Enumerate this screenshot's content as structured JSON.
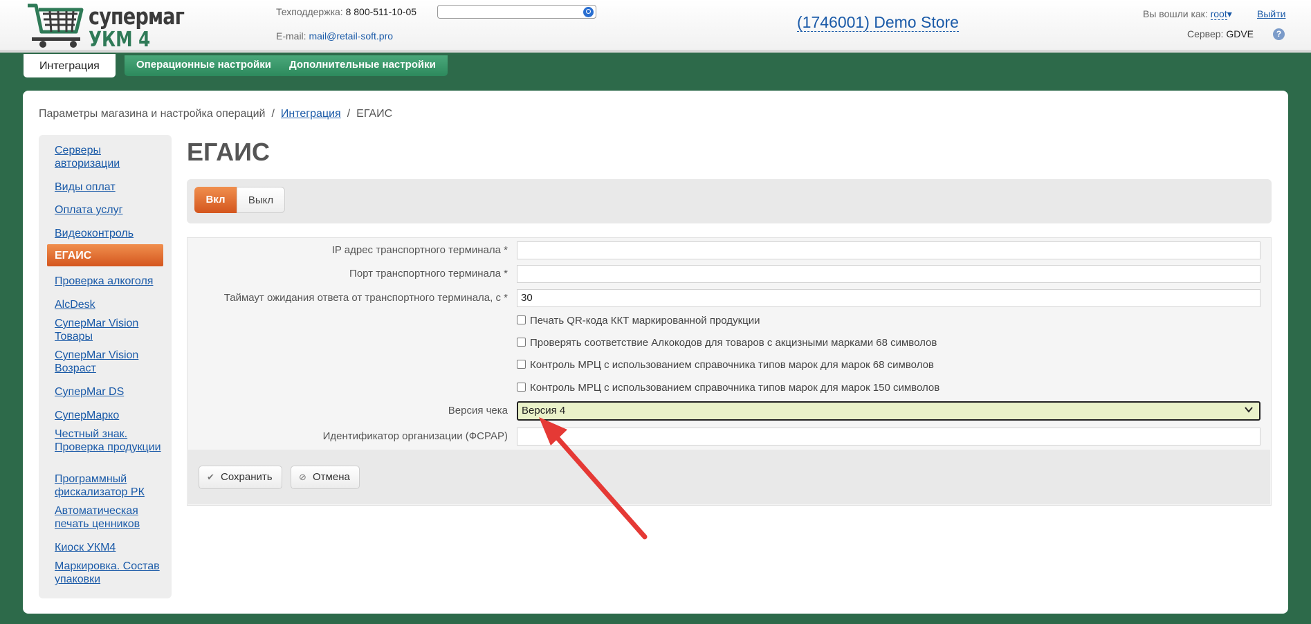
{
  "header": {
    "logo_line1": "супермаг",
    "logo_line2": "УКМ 4",
    "support_label": "Техподдержка:",
    "support_phone": "8 800-511-10-05",
    "email_label": "E-mail:",
    "email": "mail@retail-soft.pro",
    "search_placeholder": "",
    "store_title": "(1746001) Demo Store",
    "login_label": "Вы вошли как:",
    "user": "root",
    "user_caret": "▾",
    "logout": "Выйти",
    "server_label": "Сервер:",
    "server": "GDVE",
    "help_glyph": "?"
  },
  "tabs": [
    {
      "label": "Интеграция"
    },
    {
      "label": "Операционные настройки"
    },
    {
      "label": "Дополнительные настройки"
    }
  ],
  "breadcrumb": {
    "root": "Параметры магазина и настройка операций",
    "parent": "Интеграция",
    "current": "ЕГАИС",
    "sep": "/"
  },
  "sidebar": {
    "items": [
      {
        "label": "Серверы авторизации"
      },
      {
        "label": "Виды оплат"
      },
      {
        "label": "Оплата услуг"
      },
      {
        "label": "Видеоконтроль"
      },
      {
        "label": "ЕГАИС"
      },
      {
        "label": "Проверка алкоголя"
      },
      {
        "label": "AlcDesk"
      },
      {
        "label": "СупepMar Vision Товары"
      },
      {
        "label": "СупepMar Vision Возраст"
      },
      {
        "label": "СупepMar DS"
      },
      {
        "label": "СупepMapко"
      },
      {
        "label": "Честный знак. Проверка продукции"
      },
      {
        "label": "Программный фискализатор РК"
      },
      {
        "label": "Автоматическая печать ценников"
      },
      {
        "label": "Киоск УКМ4"
      },
      {
        "label": "Маркировка. Состав упаковки"
      }
    ]
  },
  "page": {
    "title": "ЕГАИС",
    "toggle_on": "Вкл",
    "toggle_off": "Выкл"
  },
  "form": {
    "ip_label": "IP адрес транспортного терминала *",
    "ip_value": "",
    "port_label": "Порт транспортного терминала *",
    "port_value": "",
    "timeout_label": "Таймаут ожидания ответа от транспортного терминала, с *",
    "timeout_value": "30",
    "checkboxes": [
      {
        "label": "Печать QR-кода ККТ маркированной продукции",
        "checked": false
      },
      {
        "label": "Проверять соответствие Алкокодов для товаров с акцизными марками 68 символов",
        "checked": false
      },
      {
        "label": "Контроль МРЦ с использованием справочника типов марок для марок 68 символов",
        "checked": false
      },
      {
        "label": "Контроль МРЦ с использованием справочника типов марок для марок 150 символов",
        "checked": false
      }
    ],
    "version_label": "Версия чека",
    "version_value": "Версия 4",
    "fsrar_label": "Идентификатор организации (ФСРАР)",
    "fsrar_value": ""
  },
  "buttons": {
    "save": "Сохранить",
    "cancel": "Отмена",
    "save_icon": "✔",
    "cancel_icon": "⊘"
  },
  "colors": {
    "background": "#2d6a4a",
    "accent_orange": "#e06a2c",
    "link": "#1a5aa8",
    "annotation_arrow": "#e53935"
  }
}
